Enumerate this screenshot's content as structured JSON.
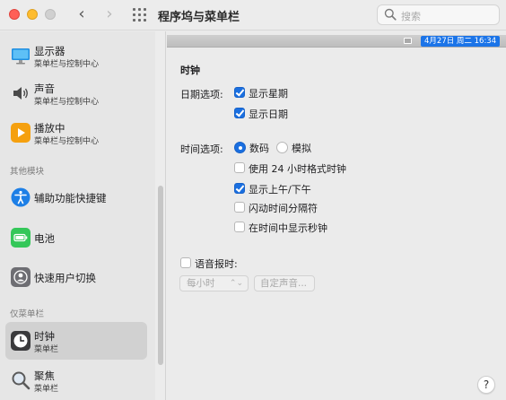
{
  "window": {
    "title": "程序坞与菜单栏",
    "search_placeholder": "搜索"
  },
  "sidebar": {
    "items": [
      {
        "name": "显示器",
        "sub": "菜单栏与控制中心",
        "icon": "display-icon"
      },
      {
        "name": "声音",
        "sub": "菜单栏与控制中心",
        "icon": "speaker-icon"
      },
      {
        "name": "播放中",
        "sub": "菜单栏与控制中心",
        "icon": "play-icon"
      }
    ],
    "section_other": "其他模块",
    "other_items": [
      {
        "name": "辅助功能快捷键",
        "icon": "accessibility-icon"
      },
      {
        "name": "电池",
        "icon": "battery-icon"
      },
      {
        "name": "快速用户切换",
        "icon": "user-switch-icon"
      }
    ],
    "section_menubar_only": "仅菜单栏",
    "menubar_items": [
      {
        "name": "时钟",
        "sub": "菜单栏",
        "icon": "clock-icon",
        "selected": true
      },
      {
        "name": "聚焦",
        "sub": "菜单栏",
        "icon": "spotlight-icon"
      }
    ]
  },
  "menubar_preview": {
    "clock_text": "4月27日 周二  16:34"
  },
  "clock": {
    "section_title": "时钟",
    "date_options_label": "日期选项:",
    "date_options": [
      {
        "label": "显示星期",
        "checked": true
      },
      {
        "label": "显示日期",
        "checked": true
      }
    ],
    "time_options_label": "时间选项:",
    "time_style": {
      "digital_label": "数码",
      "analog_label": "模拟",
      "selected": "数码"
    },
    "time_checkboxes": [
      {
        "label": "使用 24 小时格式时钟",
        "checked": false
      },
      {
        "label": "显示上午/下午",
        "checked": true
      },
      {
        "label": "闪动时间分隔符",
        "checked": false
      },
      {
        "label": "在时间中显示秒钟",
        "checked": false
      }
    ],
    "announce": {
      "label": "语音报时:",
      "checked": false
    },
    "interval_select": {
      "value": "每小时"
    },
    "custom_voice_button": "自定声音..."
  },
  "colors": {
    "accent": "#1a6fe0",
    "traffic_red": "#ff5f57",
    "traffic_yellow": "#febc2e"
  }
}
